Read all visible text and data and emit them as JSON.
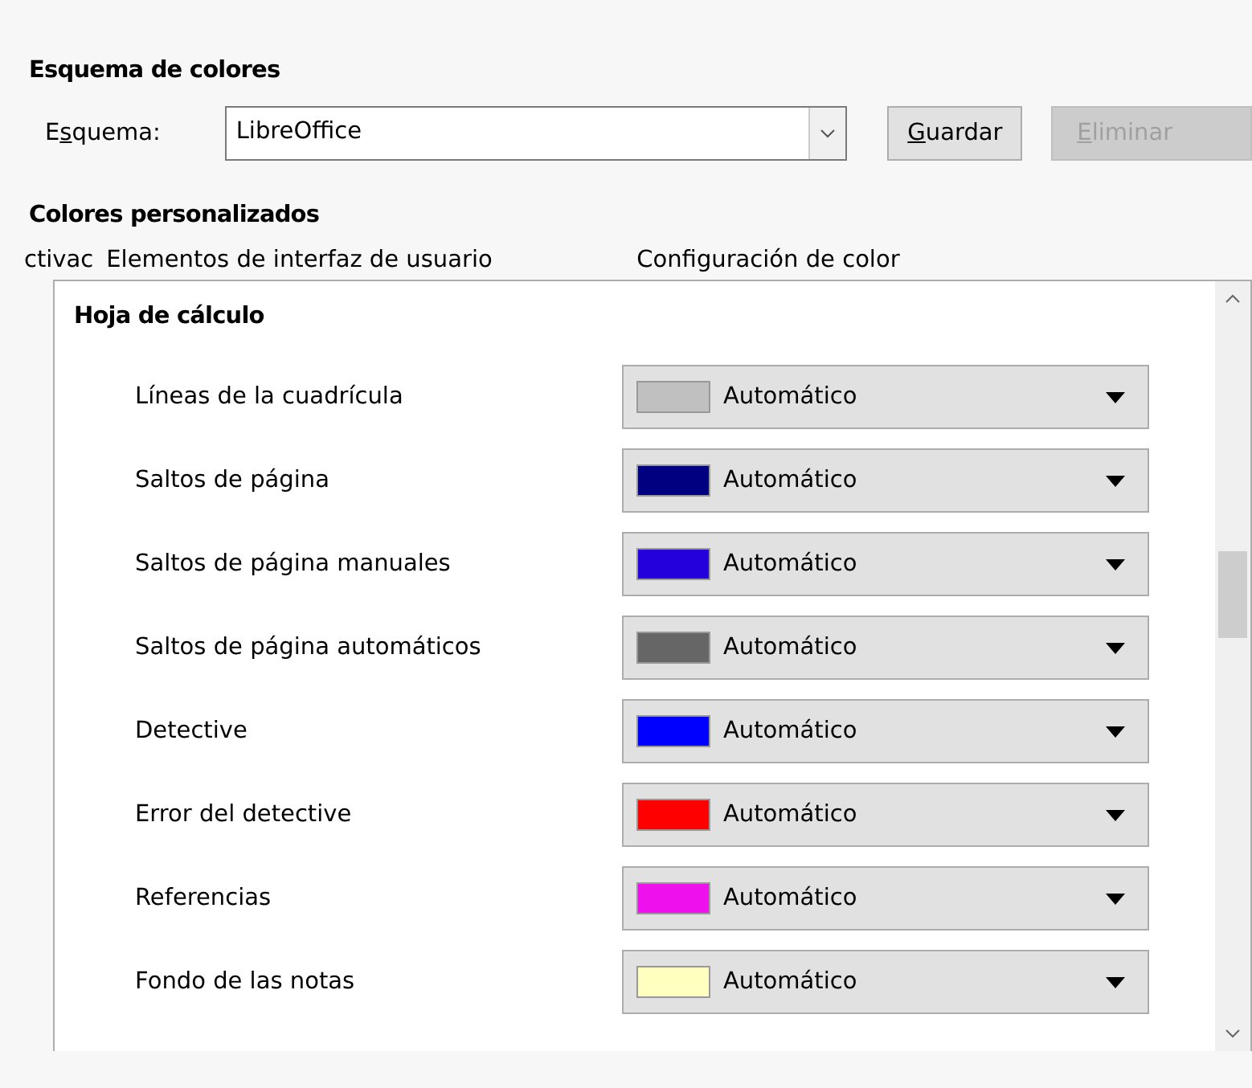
{
  "scheme_section": {
    "title": "Esquema de colores",
    "label": {
      "before": "E",
      "mnemonic": "s",
      "after": "quema:"
    },
    "value": "LibreOffice",
    "buttons": [
      {
        "label": {
          "mnemonic": "G",
          "after": "uardar"
        },
        "disabled": false
      },
      {
        "label": {
          "mnemonic": "E",
          "after": "liminar"
        },
        "disabled": true
      }
    ]
  },
  "custom_section": {
    "title": "Colores personalizados",
    "columns": [
      "ctivac",
      "Elementos de interfaz de usuario",
      "Configuración de color"
    ],
    "group": "Hoja de cálculo",
    "rows": [
      {
        "label": "Líneas de la cuadrícula",
        "color": "#c0c0c0",
        "value": "Automático"
      },
      {
        "label": "Saltos de página",
        "color": "#000080",
        "value": "Automático"
      },
      {
        "label": "Saltos de página manuales",
        "color": "#2300dc",
        "value": "Automático"
      },
      {
        "label": "Saltos de página automáticos",
        "color": "#666666",
        "value": "Automático"
      },
      {
        "label": "Detective",
        "color": "#0000ff",
        "value": "Automático"
      },
      {
        "label": "Error del detective",
        "color": "#ff0000",
        "value": "Automático"
      },
      {
        "label": "Referencias",
        "color": "#ee11ee",
        "value": "Automático"
      },
      {
        "label": "Fondo de las notas",
        "color": "#ffffc0",
        "value": "Automático"
      }
    ]
  }
}
